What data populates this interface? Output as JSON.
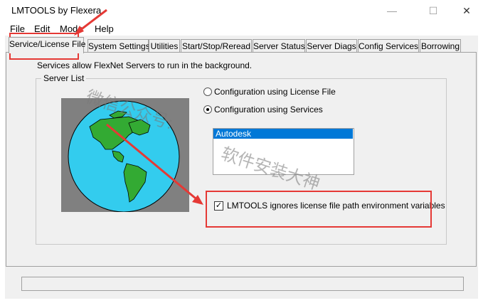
{
  "window": {
    "title": "LMTOOLS by Flexera",
    "minimize": "—",
    "maximize": "☐",
    "close": "✕"
  },
  "menu": [
    "File",
    "Edit",
    "Mode",
    "Help"
  ],
  "tabs": [
    {
      "label": "Service/License File",
      "active": true
    },
    {
      "label": "System Settings"
    },
    {
      "label": "Utilities"
    },
    {
      "label": "Start/Stop/Reread"
    },
    {
      "label": "Server Status"
    },
    {
      "label": "Server Diags"
    },
    {
      "label": "Config Services"
    },
    {
      "label": "Borrowing"
    }
  ],
  "panel": {
    "description": "Services allow FlexNet Servers to run in the background.",
    "group_label": "Server List",
    "radio_license_file": "Configuration using License File",
    "radio_services": "Configuration using Services",
    "selected_radio": "services",
    "service_list": [
      "Autodesk"
    ],
    "checkbox_label": "LMTOOLS ignores license file path environment variables",
    "checkbox_checked": true
  },
  "watermark": {
    "text1": "微信公众号:",
    "text2": "软件安装大神"
  },
  "colors": {
    "highlight_red": "#e53935",
    "selection_blue": "#0078d7",
    "ocean": "#33ccee",
    "land": "#33aa33"
  }
}
